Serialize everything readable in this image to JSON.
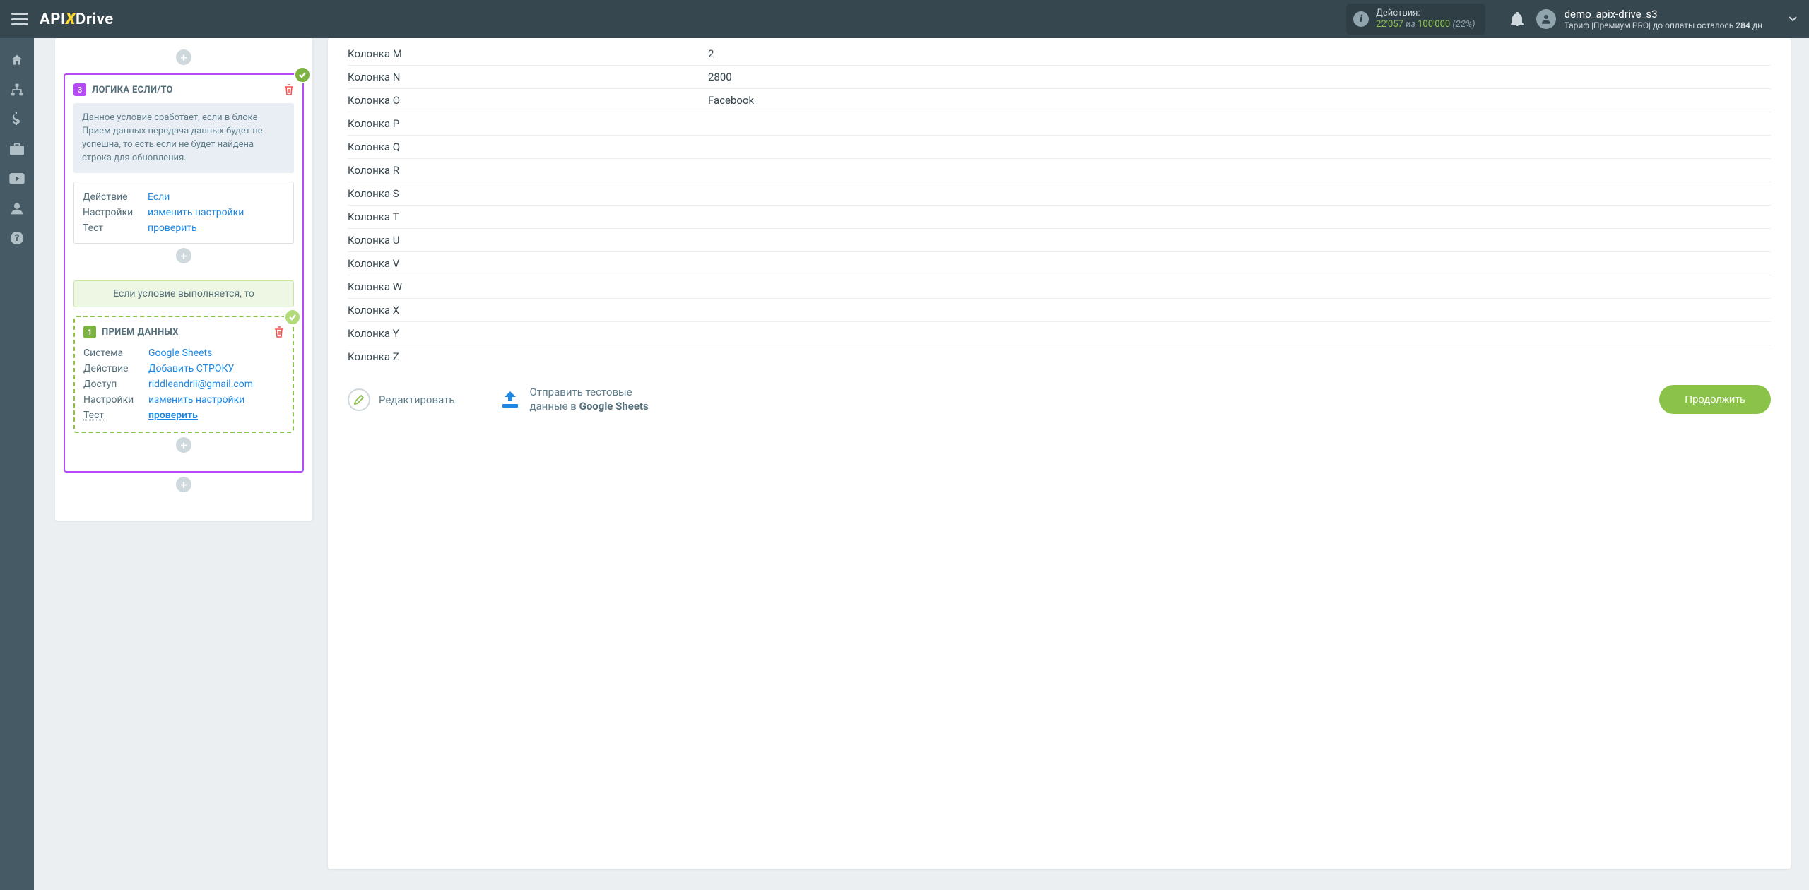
{
  "topbar": {
    "logo_pre": "API",
    "logo_post": "Drive",
    "actions_label": "Действия:",
    "actions_count": "22'057",
    "actions_of": "из",
    "actions_max": "100'000",
    "actions_pct": "(22%)",
    "username": "demo_apix-drive_s3",
    "tariff_prefix": "Тариф |Премиум PRO| до оплаты осталось ",
    "days": "284",
    "days_unit": " дн"
  },
  "leftpanel": {
    "logic": {
      "num": "3",
      "title": "ЛОГИКА ЕСЛИ/ТО",
      "note": "Данное условие сработает, если в блоке Прием данных передача данных будет не успешна, то есть если не будет найдена строка для обновления.",
      "rows": {
        "action_k": "Действие",
        "action_v": "Если",
        "settings_k": "Настройки",
        "settings_v": "изменить настройки",
        "test_k": "Тест",
        "test_v": "проверить"
      }
    },
    "condbar": "Если условие выполняется, то",
    "intake": {
      "num": "1",
      "title": "ПРИЕМ ДАННЫХ",
      "rows": {
        "system_k": "Система",
        "system_v": "Google Sheets",
        "action_k": "Действие",
        "action_v": "Добавить СТРОКУ",
        "access_k": "Доступ",
        "access_v": "riddleandrii@gmail.com",
        "settings_k": "Настройки",
        "settings_v": "изменить настройки",
        "test_k": "Тест",
        "test_v": "проверить"
      }
    }
  },
  "table": [
    {
      "k": "Колонка M",
      "v": "2"
    },
    {
      "k": "Колонка N",
      "v": "2800"
    },
    {
      "k": "Колонка O",
      "v": "Facebook"
    },
    {
      "k": "Колонка P",
      "v": ""
    },
    {
      "k": "Колонка Q",
      "v": ""
    },
    {
      "k": "Колонка R",
      "v": ""
    },
    {
      "k": "Колонка S",
      "v": ""
    },
    {
      "k": "Колонка T",
      "v": ""
    },
    {
      "k": "Колонка U",
      "v": ""
    },
    {
      "k": "Колонка V",
      "v": ""
    },
    {
      "k": "Колонка W",
      "v": ""
    },
    {
      "k": "Колонка X",
      "v": ""
    },
    {
      "k": "Колонка Y",
      "v": ""
    },
    {
      "k": "Колонка Z",
      "v": ""
    }
  ],
  "foot": {
    "edit": "Редактировать",
    "send_l1": "Отправить тестовые",
    "send_l2a": "данные в ",
    "send_l2b": "Google Sheets",
    "continue": "Продолжить"
  }
}
